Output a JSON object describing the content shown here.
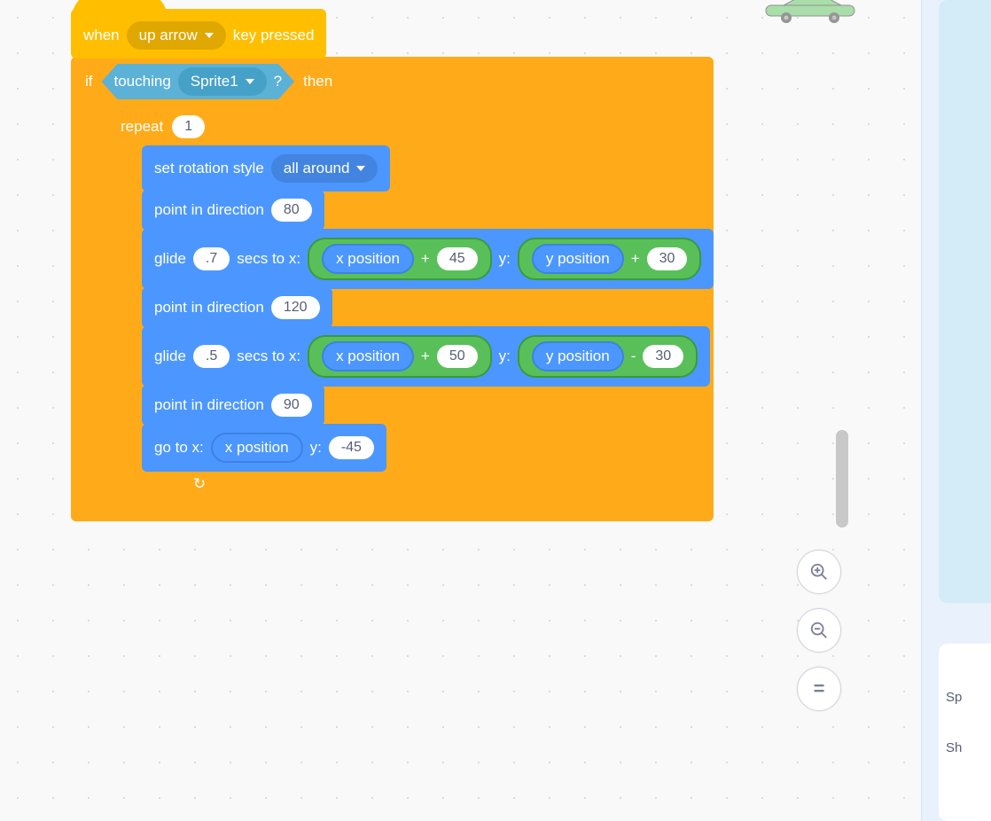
{
  "hat": {
    "when": "when",
    "key": "up arrow",
    "pressed": "key pressed"
  },
  "if": {
    "if": "if",
    "then": "then"
  },
  "touching": {
    "label": "touching",
    "target": "Sprite1",
    "q": "?"
  },
  "repeat": {
    "label": "repeat",
    "count": "1"
  },
  "setRotation": {
    "label": "set rotation style",
    "style": "all around"
  },
  "point1": {
    "label": "point in direction",
    "val": "80"
  },
  "point2": {
    "label": "point in direction",
    "val": "120"
  },
  "point3": {
    "label": "point in direction",
    "val": "90"
  },
  "glide1": {
    "glide": "glide",
    "secs": ".7",
    "secsTo": "secs to x:",
    "xpos": "x position",
    "xop": "+",
    "xadd": "45",
    "ylbl": "y:",
    "ypos": "y position",
    "yop": "+",
    "yadd": "30"
  },
  "glide2": {
    "glide": "glide",
    "secs": ".5",
    "secsTo": "secs to x:",
    "xpos": "x position",
    "xop": "+",
    "xadd": "50",
    "ylbl": "y:",
    "ypos": "y position",
    "yop": "-",
    "yadd": "30"
  },
  "goto": {
    "label": "go to x:",
    "xpos": "x position",
    "ylbl": "y:",
    "yval": "-45"
  },
  "zoom": {
    "in": "+",
    "out": "−",
    "eq": "="
  },
  "spriteInfo": {
    "l1": "Sp",
    "l2": "Sh"
  },
  "loopArrow": "↻"
}
